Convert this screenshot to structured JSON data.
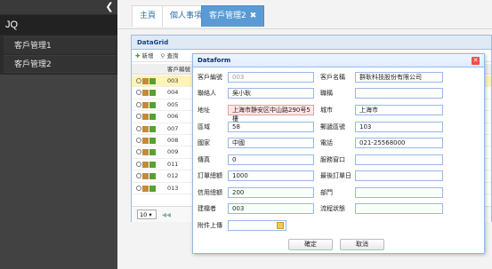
{
  "sidebar": {
    "brand": "JQ",
    "items": [
      {
        "label": "客戶管理1"
      },
      {
        "label": "客戶管理2"
      }
    ]
  },
  "tabs": [
    {
      "label": "主頁"
    },
    {
      "label": "個人事項"
    },
    {
      "label": "客戶管理2"
    }
  ],
  "grid": {
    "title": "DataGrid",
    "toolbar": {
      "add_label": "新增",
      "query_label": "查詢"
    },
    "header": {
      "code_label": "客戶編號"
    },
    "rows": [
      {
        "code": "003"
      },
      {
        "code": "004"
      },
      {
        "code": "005"
      },
      {
        "code": "006"
      },
      {
        "code": "007"
      },
      {
        "code": "008"
      },
      {
        "code": "009"
      },
      {
        "code": "011"
      },
      {
        "code": "012"
      },
      {
        "code": "013"
      }
    ],
    "right_col": [
      "",
      "",
      "",
      "",
      "",
      "",
      "",
      "",
      "",
      ""
    ],
    "page_size": "10"
  },
  "dialog": {
    "title": "Dataform",
    "fields": {
      "customer_id": {
        "label": "客戶編號",
        "value": "003"
      },
      "customer_name": {
        "label": "客戶名稱",
        "value": "群耿科技股份有限公司"
      },
      "contact": {
        "label": "聯絡人",
        "value": "吳小耿"
      },
      "title": {
        "label": "職稱",
        "value": ""
      },
      "address": {
        "label": "地址",
        "value": "上海市静安区中山路290号5樓"
      },
      "city": {
        "label": "城市",
        "value": "上海市"
      },
      "region": {
        "label": "區域",
        "value": "58"
      },
      "zip": {
        "label": "郵遞區號",
        "value": "103"
      },
      "country": {
        "label": "國家",
        "value": "中國"
      },
      "phone": {
        "label": "電話",
        "value": "021-25568000"
      },
      "fax": {
        "label": "傳真",
        "value": "0"
      },
      "contact_window": {
        "label": "服務窗口",
        "value": ""
      },
      "order_count": {
        "label": "訂單總額",
        "value": "1000"
      },
      "last_order": {
        "label": "最後訂單日",
        "value": ""
      },
      "credit": {
        "label": "信用總額",
        "value": "200"
      },
      "department": {
        "label": "部門",
        "value": ""
      },
      "creator": {
        "label": "建檔者",
        "value": "003"
      },
      "status": {
        "label": "流程狀態",
        "value": ""
      },
      "attachment": {
        "label": "附件上傳",
        "value": ""
      }
    },
    "buttons": {
      "ok": "確定",
      "cancel": "取消"
    }
  }
}
